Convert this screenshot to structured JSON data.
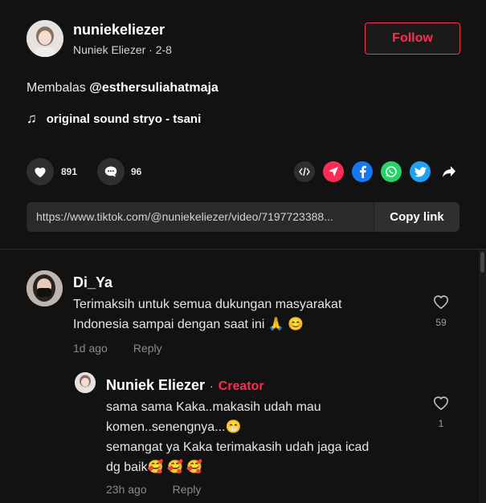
{
  "header": {
    "username": "nuniekeliezer",
    "display_name": "Nuniek Eliezer",
    "separator": " · ",
    "date": "2-8",
    "follow_label": "Follow"
  },
  "caption": {
    "prefix": "Membalas ",
    "mention": "@esthersuliahatmaja"
  },
  "music": {
    "icon": "♫",
    "title": "original sound stryo - tsani"
  },
  "stats": {
    "likes": "891",
    "comments": "96"
  },
  "share_icons": [
    "embed-icon",
    "send-icon",
    "facebook-icon",
    "whatsapp-icon",
    "twitter-icon",
    "share-arrow-icon"
  ],
  "link": {
    "url": "https://www.tiktok.com/@nuniekeliezer/video/7197723388...",
    "copy_label": "Copy link"
  },
  "comments": [
    {
      "name": "Di_Ya",
      "line1": "Terimaksih untuk semua dukungan masyarakat",
      "line2": "Indonesia sampai dengan saat ini 🙏 😊",
      "time": "1d ago",
      "reply_label": "Reply",
      "likes": "59"
    }
  ],
  "reply": {
    "name": "Nuniek Eliezer",
    "dot": "·",
    "badge": "Creator",
    "line1": "sama sama Kaka..makasih udah mau",
    "line2": "komen..senengnya...😁",
    "line3": "semangat ya Kaka terimakasih udah jaga icad",
    "line4": "dg baik🥰 🥰 🥰",
    "time": "23h ago",
    "reply_label": "Reply",
    "likes": "1"
  },
  "colors": {
    "accent": "#fe2c55",
    "background": "#121212",
    "send": "#fe2c55",
    "facebook": "#1877f2",
    "whatsapp": "#25d366",
    "twitter": "#1da1f2"
  }
}
